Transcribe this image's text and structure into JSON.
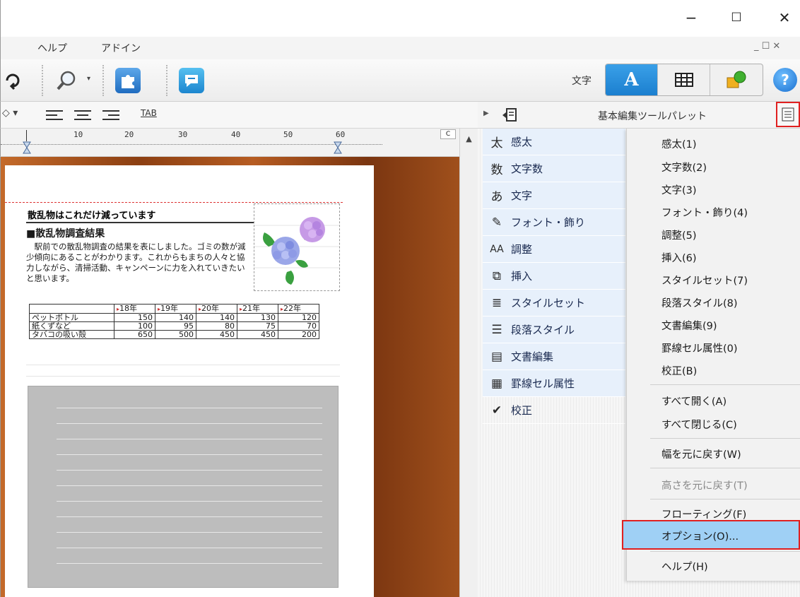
{
  "window": {
    "minimize_label": "−",
    "maximize_label": "☐",
    "close_label": "✕"
  },
  "menubar": {
    "items": [
      "ヘルプ",
      "アドイン"
    ],
    "doc_controls": "_ ☐ ✕"
  },
  "toolbar": {
    "mode_label": "文字",
    "mode_buttons": [
      "A",
      "",
      ""
    ],
    "help_label": "?"
  },
  "formatbar": {
    "tab_label": "TAB"
  },
  "ruler": {
    "numbers": [
      "10",
      "20",
      "30",
      "40",
      "50",
      "60"
    ],
    "corner_label": "C"
  },
  "document": {
    "title": "散乱物はこれだけ減っています",
    "heading": "■散乱物調査結果",
    "body": "　駅前での散乱物調査の結果を表にしました。ゴミの数が減少傾向にあることがわかります。これからもまちの人々と協力しながら、清掃活動、キャンペーンに力を入れていきたいと思います。",
    "table": {
      "headers": [
        "",
        "18年",
        "19年",
        "20年",
        "21年",
        "22年"
      ],
      "rows": [
        [
          "ペットボトル",
          "150",
          "140",
          "140",
          "130",
          "120"
        ],
        [
          "紙くずなど",
          "100",
          "95",
          "80",
          "75",
          "70"
        ],
        [
          "タバコの吸い殻",
          "650",
          "500",
          "450",
          "450",
          "200"
        ]
      ]
    }
  },
  "palette": {
    "title": "基本編集ツールパレット",
    "items": [
      {
        "icon": "太",
        "label": "感太"
      },
      {
        "icon": "数",
        "label": "文字数"
      },
      {
        "icon": "あ",
        "label": "文字"
      },
      {
        "icon": "✎",
        "label": "フォント・飾り"
      },
      {
        "icon": "AA",
        "label": "調整"
      },
      {
        "icon": "⧉",
        "label": "挿入"
      },
      {
        "icon": "≣",
        "label": "スタイルセット"
      },
      {
        "icon": "☰",
        "label": "段落スタイル"
      },
      {
        "icon": "▤",
        "label": "文書編集"
      },
      {
        "icon": "▦",
        "label": "罫線セル属性"
      },
      {
        "icon": "✔",
        "label": "校正"
      }
    ]
  },
  "dropdown": {
    "items": [
      "感太(1)",
      "文字数(2)",
      "文字(3)",
      "フォント・飾り(4)",
      "調整(5)",
      "挿入(6)",
      "スタイルセット(7)",
      "段落スタイル(8)",
      "文書編集(9)",
      "罫線セル属性(0)",
      "校正(B)",
      "すべて開く(A)",
      "すべて閉じる(C)",
      "幅を元に戻す(W)",
      "高さを元に戻す(T)",
      "フローティング(F)",
      "オプション(O)...",
      "ヘルプ(H)"
    ]
  },
  "colors": {
    "accent_blue": "#1b7fcf",
    "highlight_red": "#e02020",
    "menu_highlight": "#9fd0f5"
  }
}
